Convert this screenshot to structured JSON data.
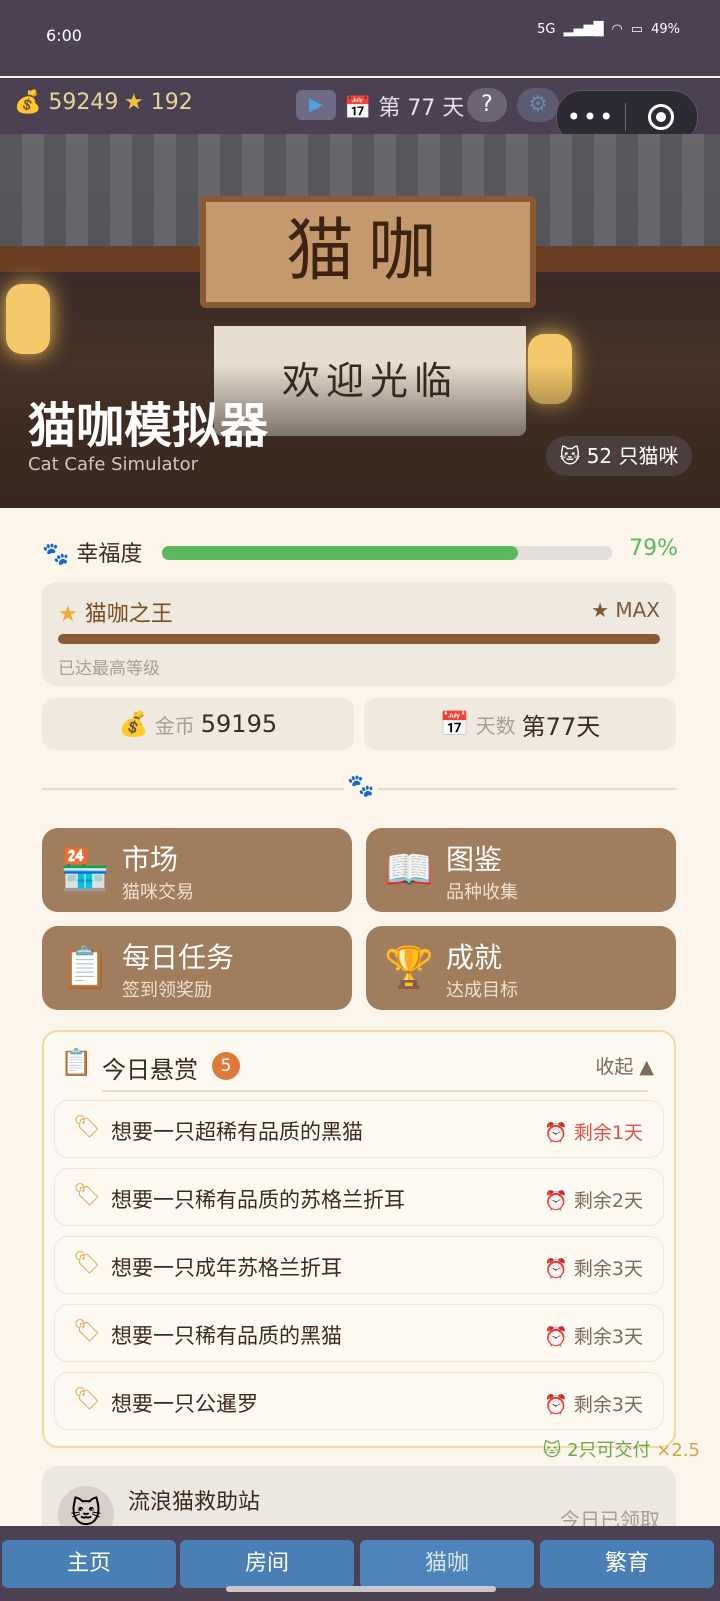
{
  "status_bar": {
    "time": "6:00",
    "network": "5G",
    "battery": "49%"
  },
  "topbar": {
    "coins": "59249",
    "stars": "192",
    "day": "第 77 天",
    "help": "?"
  },
  "hero": {
    "sign": "猫咖",
    "curtain": "欢迎光临",
    "title": "猫咖模拟器",
    "subtitle": "Cat Cafe Simulator",
    "cat_count": "52 只猫咪"
  },
  "happiness": {
    "label": "幸福度",
    "value": "79%",
    "fraction": 0.79,
    "color": "#5cb85c"
  },
  "level": {
    "name": "猫咖之王",
    "max": "★ MAX",
    "note": "已达最高等级"
  },
  "stats": {
    "coins_label": "金币",
    "coins": "59195",
    "days_label": "天数",
    "days": "第77天"
  },
  "menu": [
    {
      "title": "市场",
      "sub": "猫咪交易",
      "icon": "shop-icon"
    },
    {
      "title": "图鉴",
      "sub": "品种收集",
      "icon": "book-icon"
    },
    {
      "title": "每日任务",
      "sub": "签到领奖励",
      "icon": "clipboard-icon"
    },
    {
      "title": "成就",
      "sub": "达成目标",
      "icon": "trophy-icon"
    }
  ],
  "bounty": {
    "title": "今日悬赏",
    "count": "5",
    "collapse": "收起 ▲",
    "items": [
      {
        "text": "想要一只超稀有品质的黑猫",
        "time": "剩余1天"
      },
      {
        "text": "想要一只稀有品质的苏格兰折耳",
        "time": "剩余2天"
      },
      {
        "text": "想要一只成年苏格兰折耳",
        "time": "剩余3天"
      },
      {
        "text": "想要一只稀有品质的黑猫",
        "time": "剩余3天"
      },
      {
        "text": "想要一只公暹罗",
        "time": "剩余3天"
      }
    ],
    "deliver": "2只可交付",
    "multiplier": "×2.5"
  },
  "rescue": {
    "title": "流浪猫救助站",
    "status": "今日已领取"
  },
  "tabs": [
    "主页",
    "房间",
    "猫咖",
    "繁育"
  ],
  "colors": {
    "accent": "#a07d5c",
    "tab": "#4a7fb5",
    "urgent": "#d9534f"
  }
}
